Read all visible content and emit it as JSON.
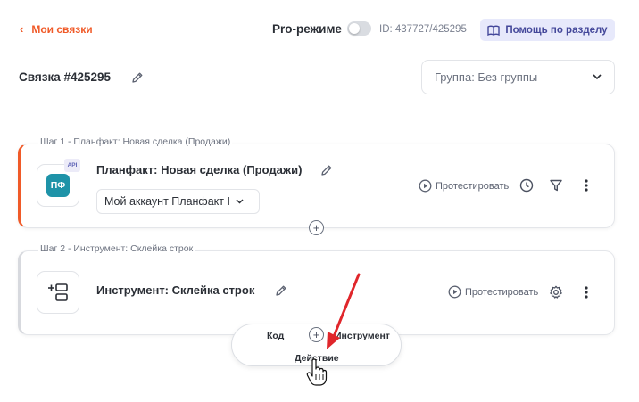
{
  "header": {
    "back_label": "Мои связки",
    "pro_label": "Pro-режиме",
    "pro_enabled": false,
    "id_text": "ID: 437727/425295",
    "help_label": "Помощь по разделу"
  },
  "bundle": {
    "title": "Связка #425295",
    "group_select_value": "Группа: Без группы"
  },
  "steps": [
    {
      "label": "Шаг 1 - Планфакт: Новая сделка (Продажи)",
      "name": "Планфакт: Новая сделка (Продажи)",
      "icon_text": "ПФ",
      "badge": "API",
      "account": "Мой аккаунт Планфакт I",
      "test_label": "Протестировать"
    },
    {
      "label": "Шаг 2 - Инструмент: Склейка строк",
      "name": "Инструмент: Склейка строк",
      "test_label": "Протестировать"
    }
  ],
  "add_popup": {
    "items": [
      "Код",
      "Инструмент",
      "Действие"
    ]
  },
  "colors": {
    "accent": "#f05a28",
    "help_bg": "#e7e9fb",
    "help_text": "#44489a",
    "planfact_tile": "#1e93a8",
    "arrow": "#e0262b"
  }
}
